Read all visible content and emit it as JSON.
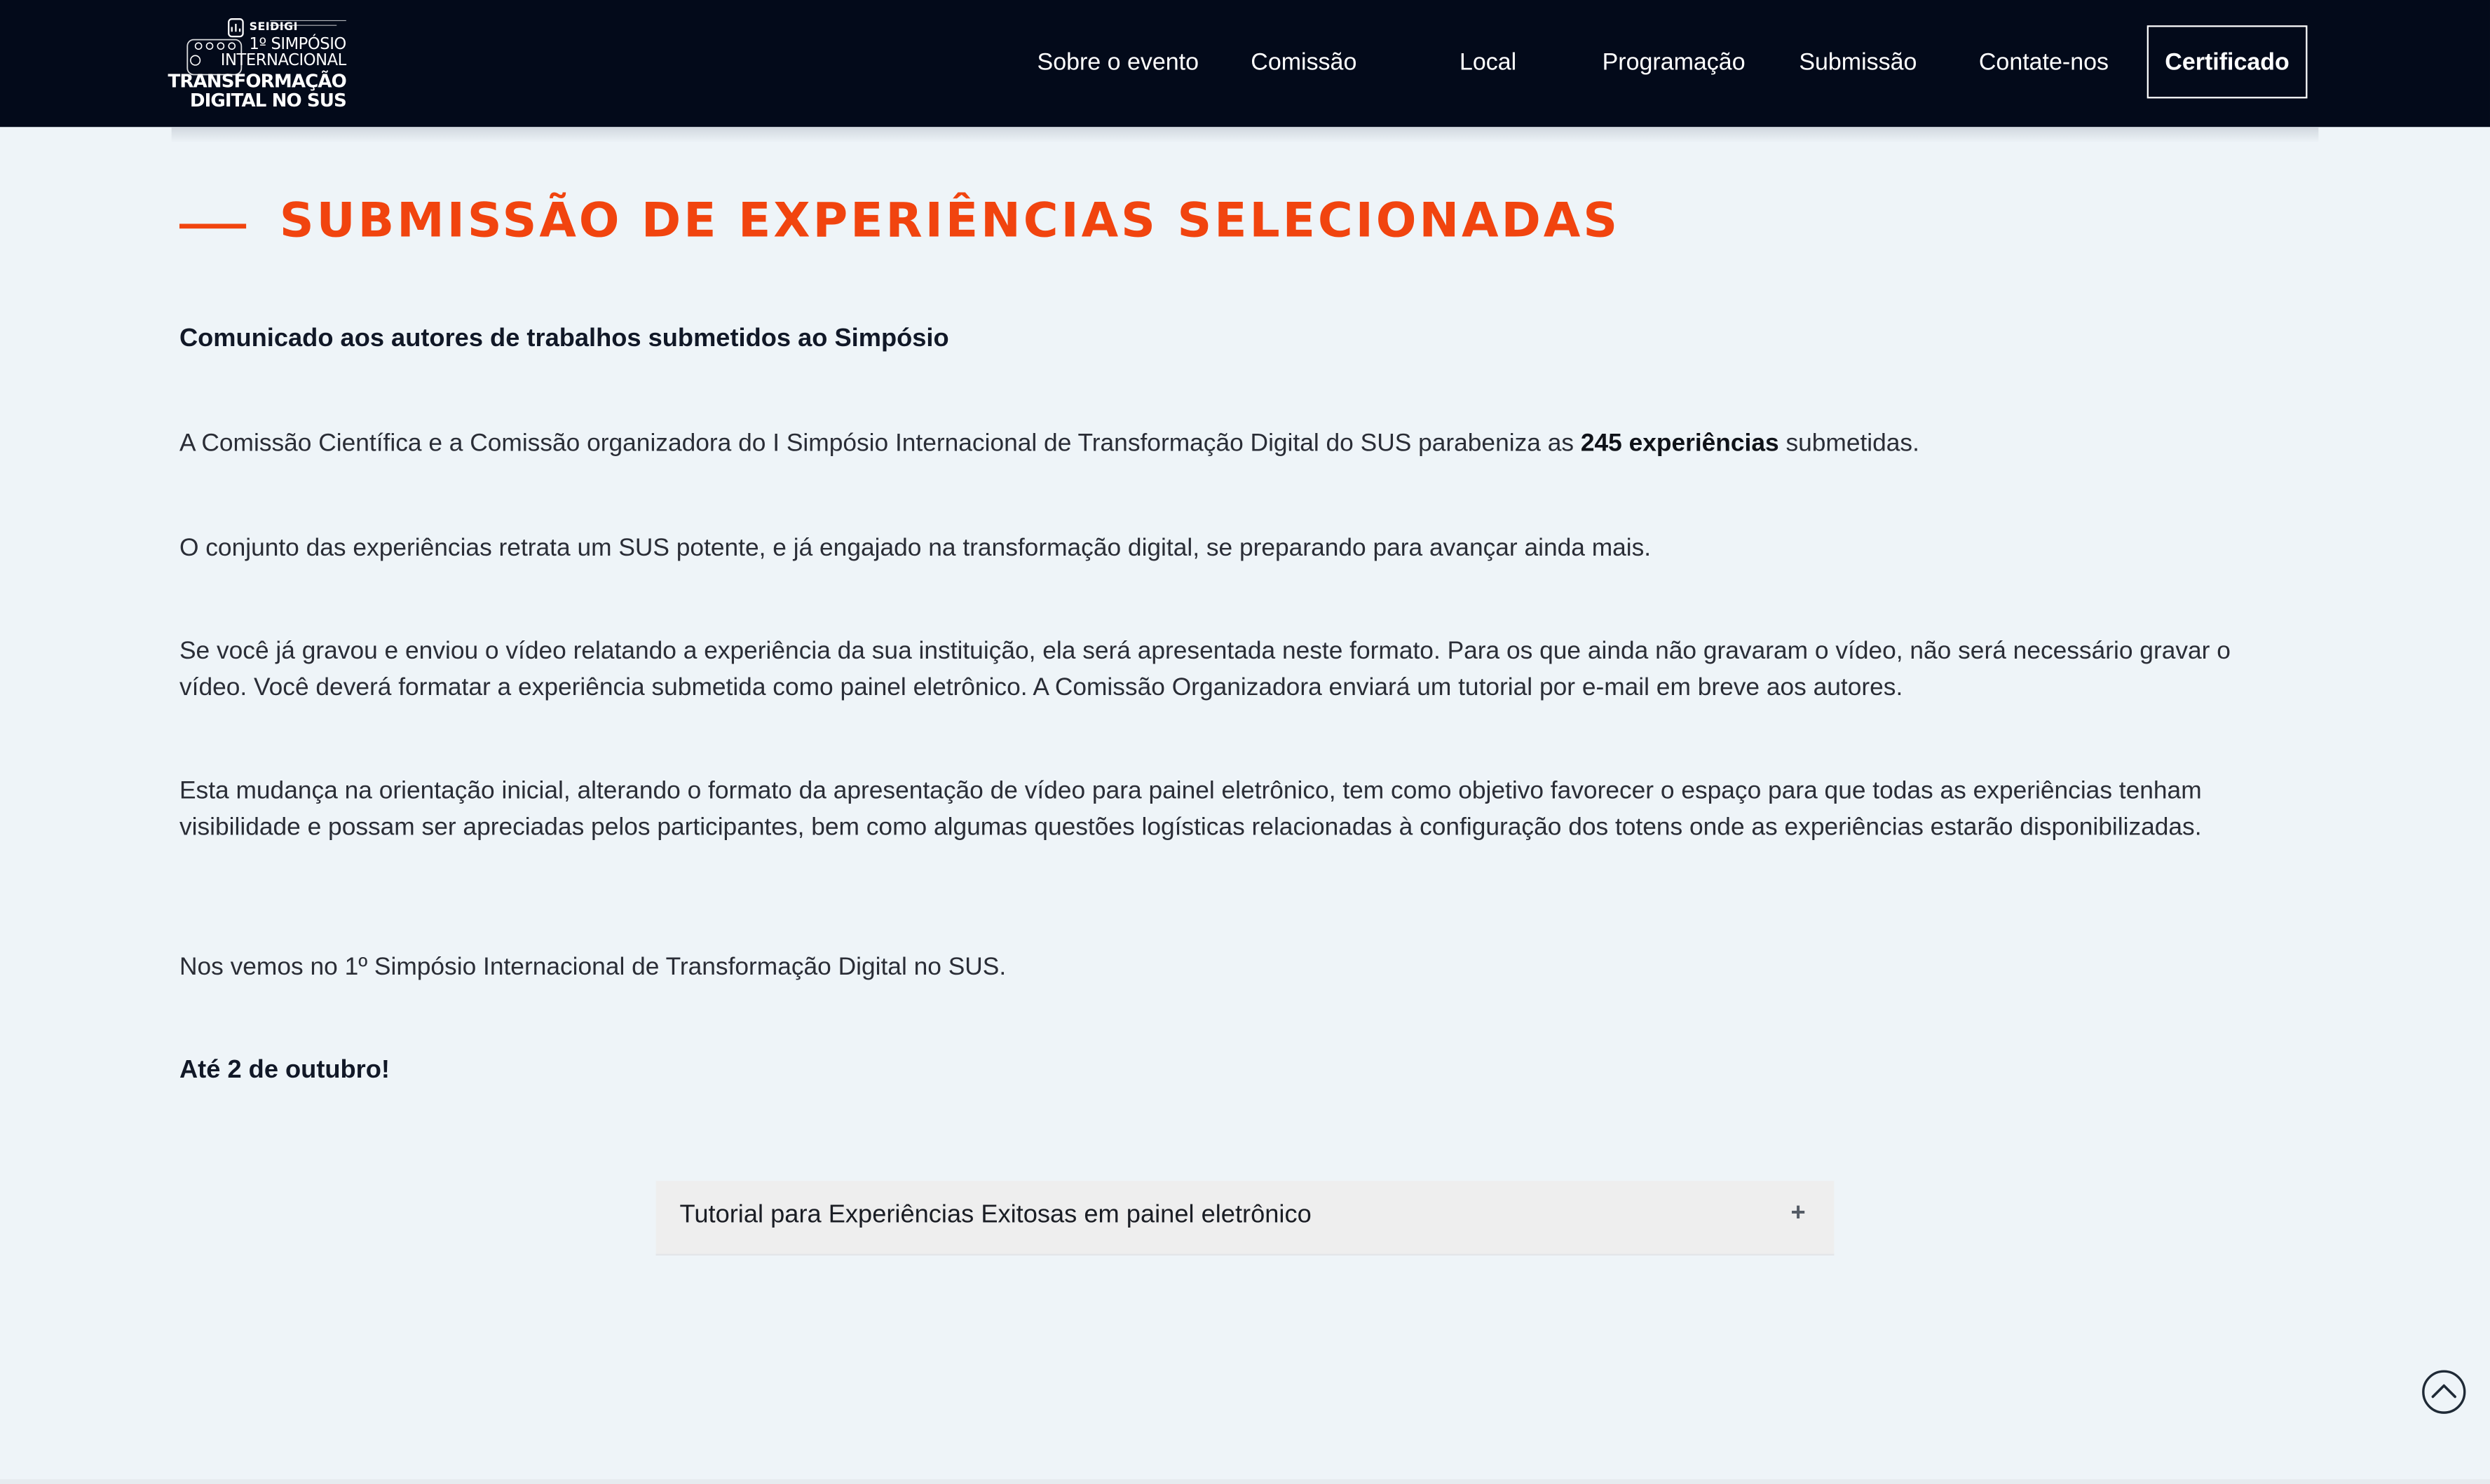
{
  "header": {
    "logo": {
      "brand": "SEIDIGI",
      "line1": "1º SIMPÓSIO",
      "line2": "INTERNACIONAL",
      "line3": "TRANSFORMAÇÃO",
      "line4": "DIGITAL NO SUS"
    },
    "nav": [
      {
        "label": "Sobre o evento"
      },
      {
        "label": "Comissão"
      },
      {
        "label": "Local"
      },
      {
        "label": "Programação"
      },
      {
        "label": "Submissão"
      },
      {
        "label": "Contate-nos"
      }
    ],
    "cta_label": "Certificado"
  },
  "main": {
    "title": "SUBMISSÃO DE EXPERIÊNCIAS SELECIONADAS",
    "subheading": "Comunicado aos autores de trabalhos submetidos ao Simpósio",
    "p1_before": "A Comissão Científica e a Comissão organizadora do I Simpósio Internacional de Transformação Digital do SUS parabeniza as ",
    "p1_bold": "245 experiências",
    "p1_after": " submetidas.",
    "p2": "O conjunto das experiências retrata um SUS potente, e já engajado na transformação digital, se preparando para avançar ainda mais.",
    "p3": "Se você já gravou e enviou o vídeo relatando a experiência da sua instituição, ela será apresentada neste formato. Para os que ainda não gravaram o vídeo, não será necessário gravar o vídeo. Você deverá formatar a experiência submetida como painel eletrônico. A Comissão Organizadora enviará um tutorial por e-mail em breve aos autores.",
    "p4": "Esta mudança na orientação inicial, alterando o formato da apresentação de vídeo para painel eletrônico, tem como objetivo favorecer o espaço para que todas as experiências tenham visibilidade e possam ser apreciadas pelos participantes, bem como algumas questões logísticas relacionadas à configuração dos totens onde as experiências estarão disponibilizadas.",
    "p5": "Nos vemos no 1º Simpósio Internacional de Transformação Digital no SUS.",
    "closing": "Até 2 de outubro!",
    "accordion": {
      "label": "Tutorial para Experiências Exitosas em painel eletrônico",
      "toggle": "+"
    }
  },
  "colors": {
    "header_bg": "#030a1a",
    "accent": "#f1440f",
    "page_bg": "#eef4f8"
  },
  "icons": {
    "scroll_top": "chevron-up-circle-icon",
    "accordion_toggle": "plus-icon"
  }
}
